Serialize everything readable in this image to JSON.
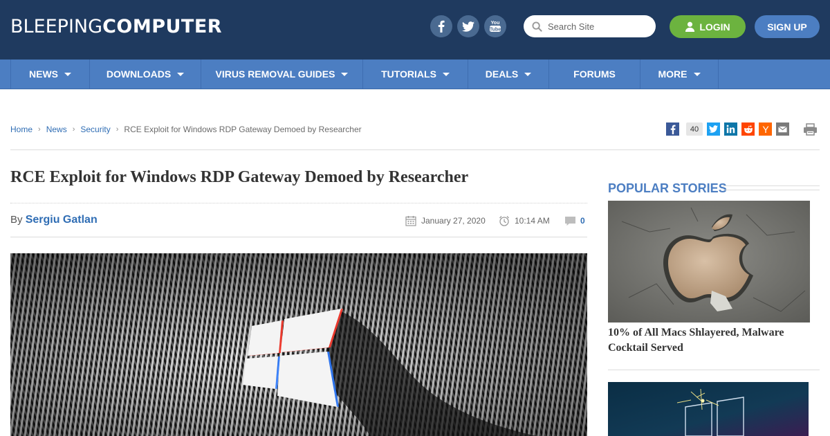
{
  "header": {
    "logo_light": "BLEEPING",
    "logo_bold": "COMPUTER",
    "social_icons": [
      "facebook-icon",
      "twitter-icon",
      "youtube-icon"
    ],
    "search_placeholder": "Search Site",
    "login_label": "LOGIN",
    "signup_label": "SIGN UP",
    "colors": {
      "header_bg": "#1f3a5f",
      "login": "#6cb33f",
      "signup": "#4c7ec2"
    }
  },
  "nav": {
    "color": "#4c7ec2",
    "items": [
      {
        "label": "NEWS",
        "dropdown": true
      },
      {
        "label": "DOWNLOADS",
        "dropdown": true
      },
      {
        "label": "VIRUS REMOVAL GUIDES",
        "dropdown": true
      },
      {
        "label": "TUTORIALS",
        "dropdown": true
      },
      {
        "label": "DEALS",
        "dropdown": true
      },
      {
        "label": "FORUMS",
        "dropdown": false
      },
      {
        "label": "MORE",
        "dropdown": true
      }
    ]
  },
  "breadcrumb": {
    "items": [
      "Home",
      "News",
      "Security"
    ],
    "current": "RCE Exploit for Windows RDP Gateway Demoed by Researcher"
  },
  "share": {
    "count": "40",
    "icons": [
      "facebook-icon",
      "twitter-icon",
      "linkedin-icon",
      "reddit-icon",
      "hackernews-icon",
      "email-icon",
      "print-icon"
    ]
  },
  "article": {
    "title": "RCE Exploit for Windows RDP Gateway Demoed by Researcher",
    "by_label": "By",
    "author": "Sergiu Gatlan",
    "date": "January 27, 2020",
    "time": "10:14 AM",
    "comments_count": "0"
  },
  "sidebar": {
    "heading": "POPULAR STORIES",
    "stories": [
      {
        "title": "10% of All Macs Shlayered, Malware Cocktail Served"
      }
    ]
  }
}
